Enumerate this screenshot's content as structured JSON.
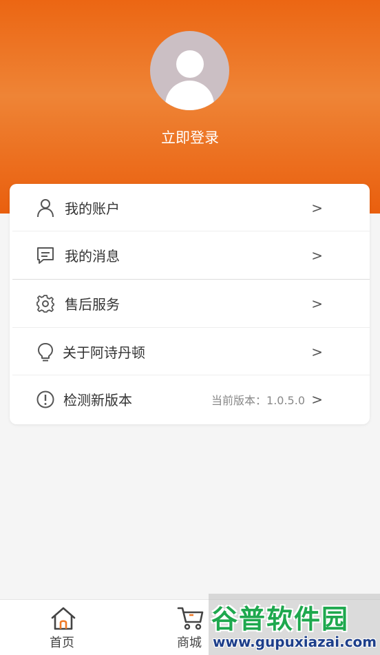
{
  "profile": {
    "login_label": "立即登录"
  },
  "menu": {
    "items": [
      {
        "label": "我的账户",
        "icon": "user-icon",
        "arrow": ">"
      },
      {
        "label": "我的消息",
        "icon": "message-icon",
        "arrow": ">"
      },
      {
        "label": "售后服务",
        "icon": "gear-icon",
        "arrow": ">"
      },
      {
        "label": "关于阿诗丹顿",
        "icon": "lightbulb-icon",
        "arrow": ">"
      },
      {
        "label": "检测新版本",
        "icon": "info-icon",
        "arrow": ">",
        "extra": "当前版本：1.0.5.0"
      }
    ]
  },
  "tabbar": {
    "tabs": [
      {
        "label": "首页",
        "icon": "home-icon"
      },
      {
        "label": "商城",
        "icon": "cart-icon"
      }
    ]
  },
  "watermark": {
    "title": "谷普软件园",
    "url": "www.gupuxiazai.com"
  },
  "colors": {
    "header_orange": "#ec6613",
    "accent_orange": "#f07a28",
    "watermark_green": "#1ea84e"
  }
}
